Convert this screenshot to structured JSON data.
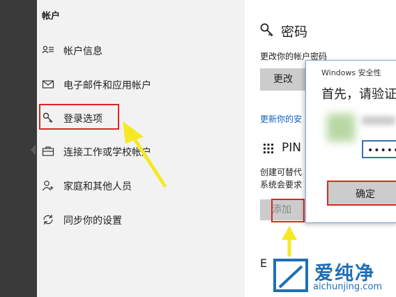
{
  "nav": {
    "title": "帐户",
    "items": [
      {
        "label": "帐户信息",
        "icon": "person-card-icon"
      },
      {
        "label": "电子邮件和应用帐户",
        "icon": "mail-icon"
      },
      {
        "label": "登录选项",
        "icon": "key-icon"
      },
      {
        "label": "连接工作或学校帐户",
        "icon": "briefcase-icon"
      },
      {
        "label": "家庭和其他人员",
        "icon": "person-add-icon"
      },
      {
        "label": "同步你的设置",
        "icon": "sync-icon"
      }
    ]
  },
  "password": {
    "title": "密码",
    "change_label": "更改你的帐户密码",
    "change_button": "更改",
    "update_link": "更新你的安"
  },
  "pin": {
    "title": "PIN",
    "desc_line1": "创建可替代",
    "desc_line2": "系统会要求",
    "add_button": "添加"
  },
  "partial_letter": "E",
  "dialog": {
    "title": "Windows 安全性",
    "heading": "首先，请验证",
    "password_mask": "•••••",
    "ok_button": "确定"
  },
  "watermark": {
    "name": "爱纯净",
    "url": "aichunjing.com"
  },
  "colors": {
    "highlight": "#e02424",
    "arrow": "#f5e923",
    "link": "#0a63c9"
  }
}
